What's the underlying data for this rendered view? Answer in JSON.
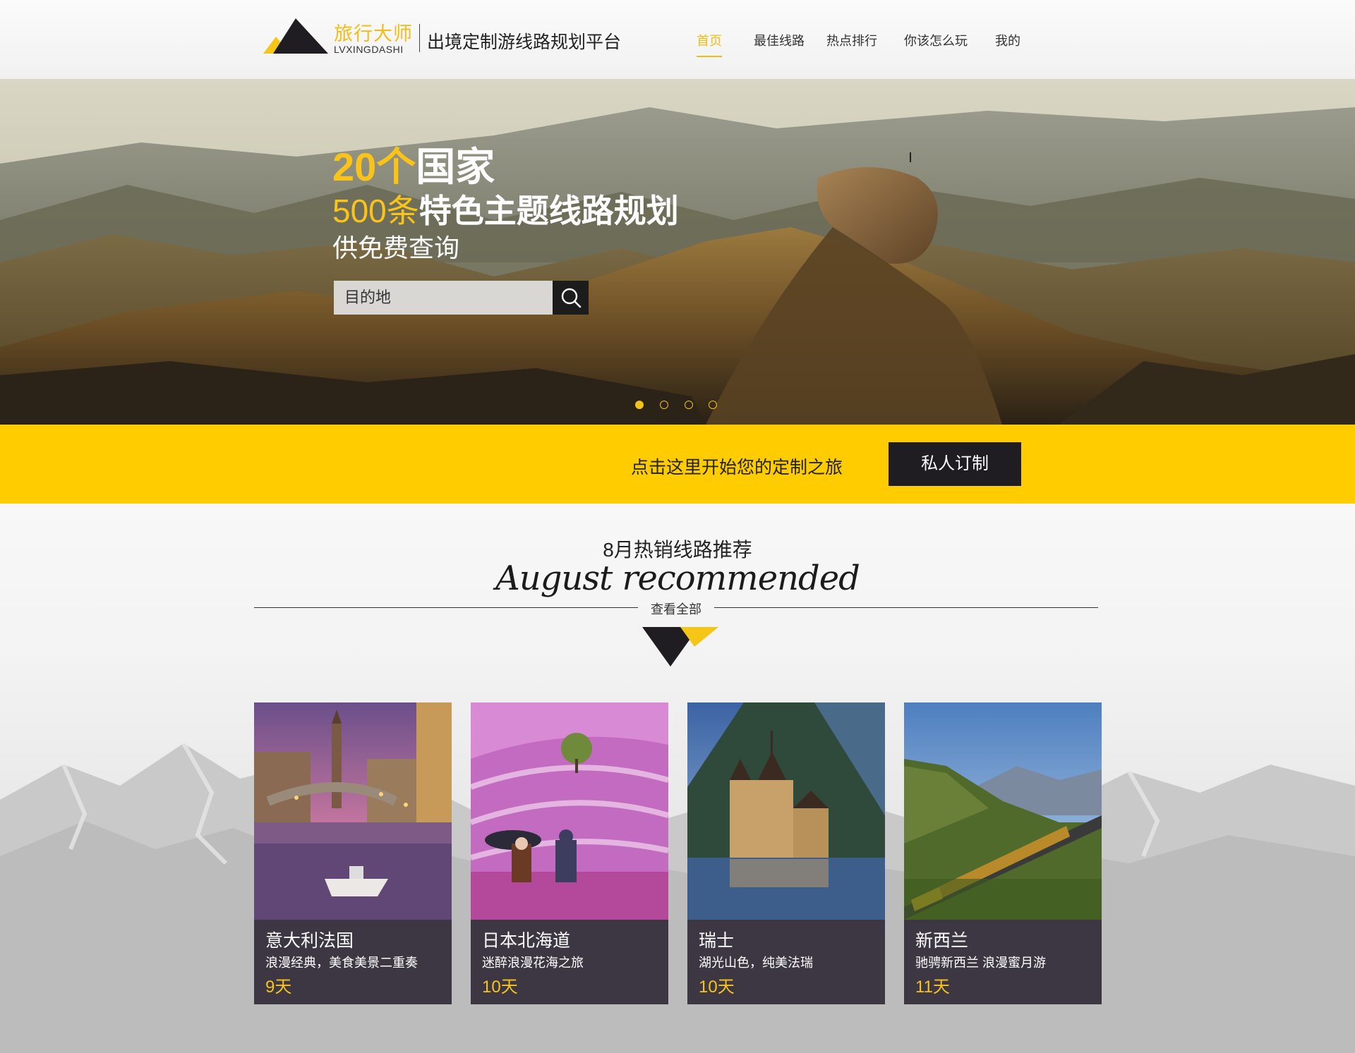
{
  "brand": {
    "name_cn": "旅行大师",
    "name_en": "LVXINGDASHI",
    "slogan": "出境定制游线路规划平台",
    "colors": {
      "accent": "#ffcc00",
      "dark": "#1f1c22"
    }
  },
  "nav": {
    "items": [
      {
        "label": "首页",
        "active": true
      },
      {
        "label": "最佳线路",
        "active": false
      },
      {
        "label": "热点排行",
        "active": false
      },
      {
        "label": "你该怎么玩",
        "active": false
      },
      {
        "label": "我的",
        "active": false
      }
    ]
  },
  "hero": {
    "line1_highlight": "20个",
    "line1_rest": "国家",
    "line2_highlight": "500条",
    "line2_rest": "特色主题线路规划",
    "line3": "供免费查询",
    "search_placeholder": "目的地",
    "search_icon": "search-icon",
    "slides": 4,
    "active_slide": 1
  },
  "banner": {
    "text": "点击这里开始您的定制之旅",
    "button": "私人订制"
  },
  "recommend": {
    "title": "8月热销线路推荐",
    "subtitle": "August recommended",
    "view_all": "查看全部",
    "cards": [
      {
        "name": "意大利法国",
        "desc": "浪漫经典，美食美景二重奏",
        "days": "9天"
      },
      {
        "name": "日本北海道",
        "desc": "迷醉浪漫花海之旅",
        "days": "10天"
      },
      {
        "name": "瑞士",
        "desc": "湖光山色，纯美法瑞",
        "days": "10天"
      },
      {
        "name": "新西兰",
        "desc": "驰骋新西兰 浪漫蜜月游",
        "days": "11天"
      }
    ]
  }
}
